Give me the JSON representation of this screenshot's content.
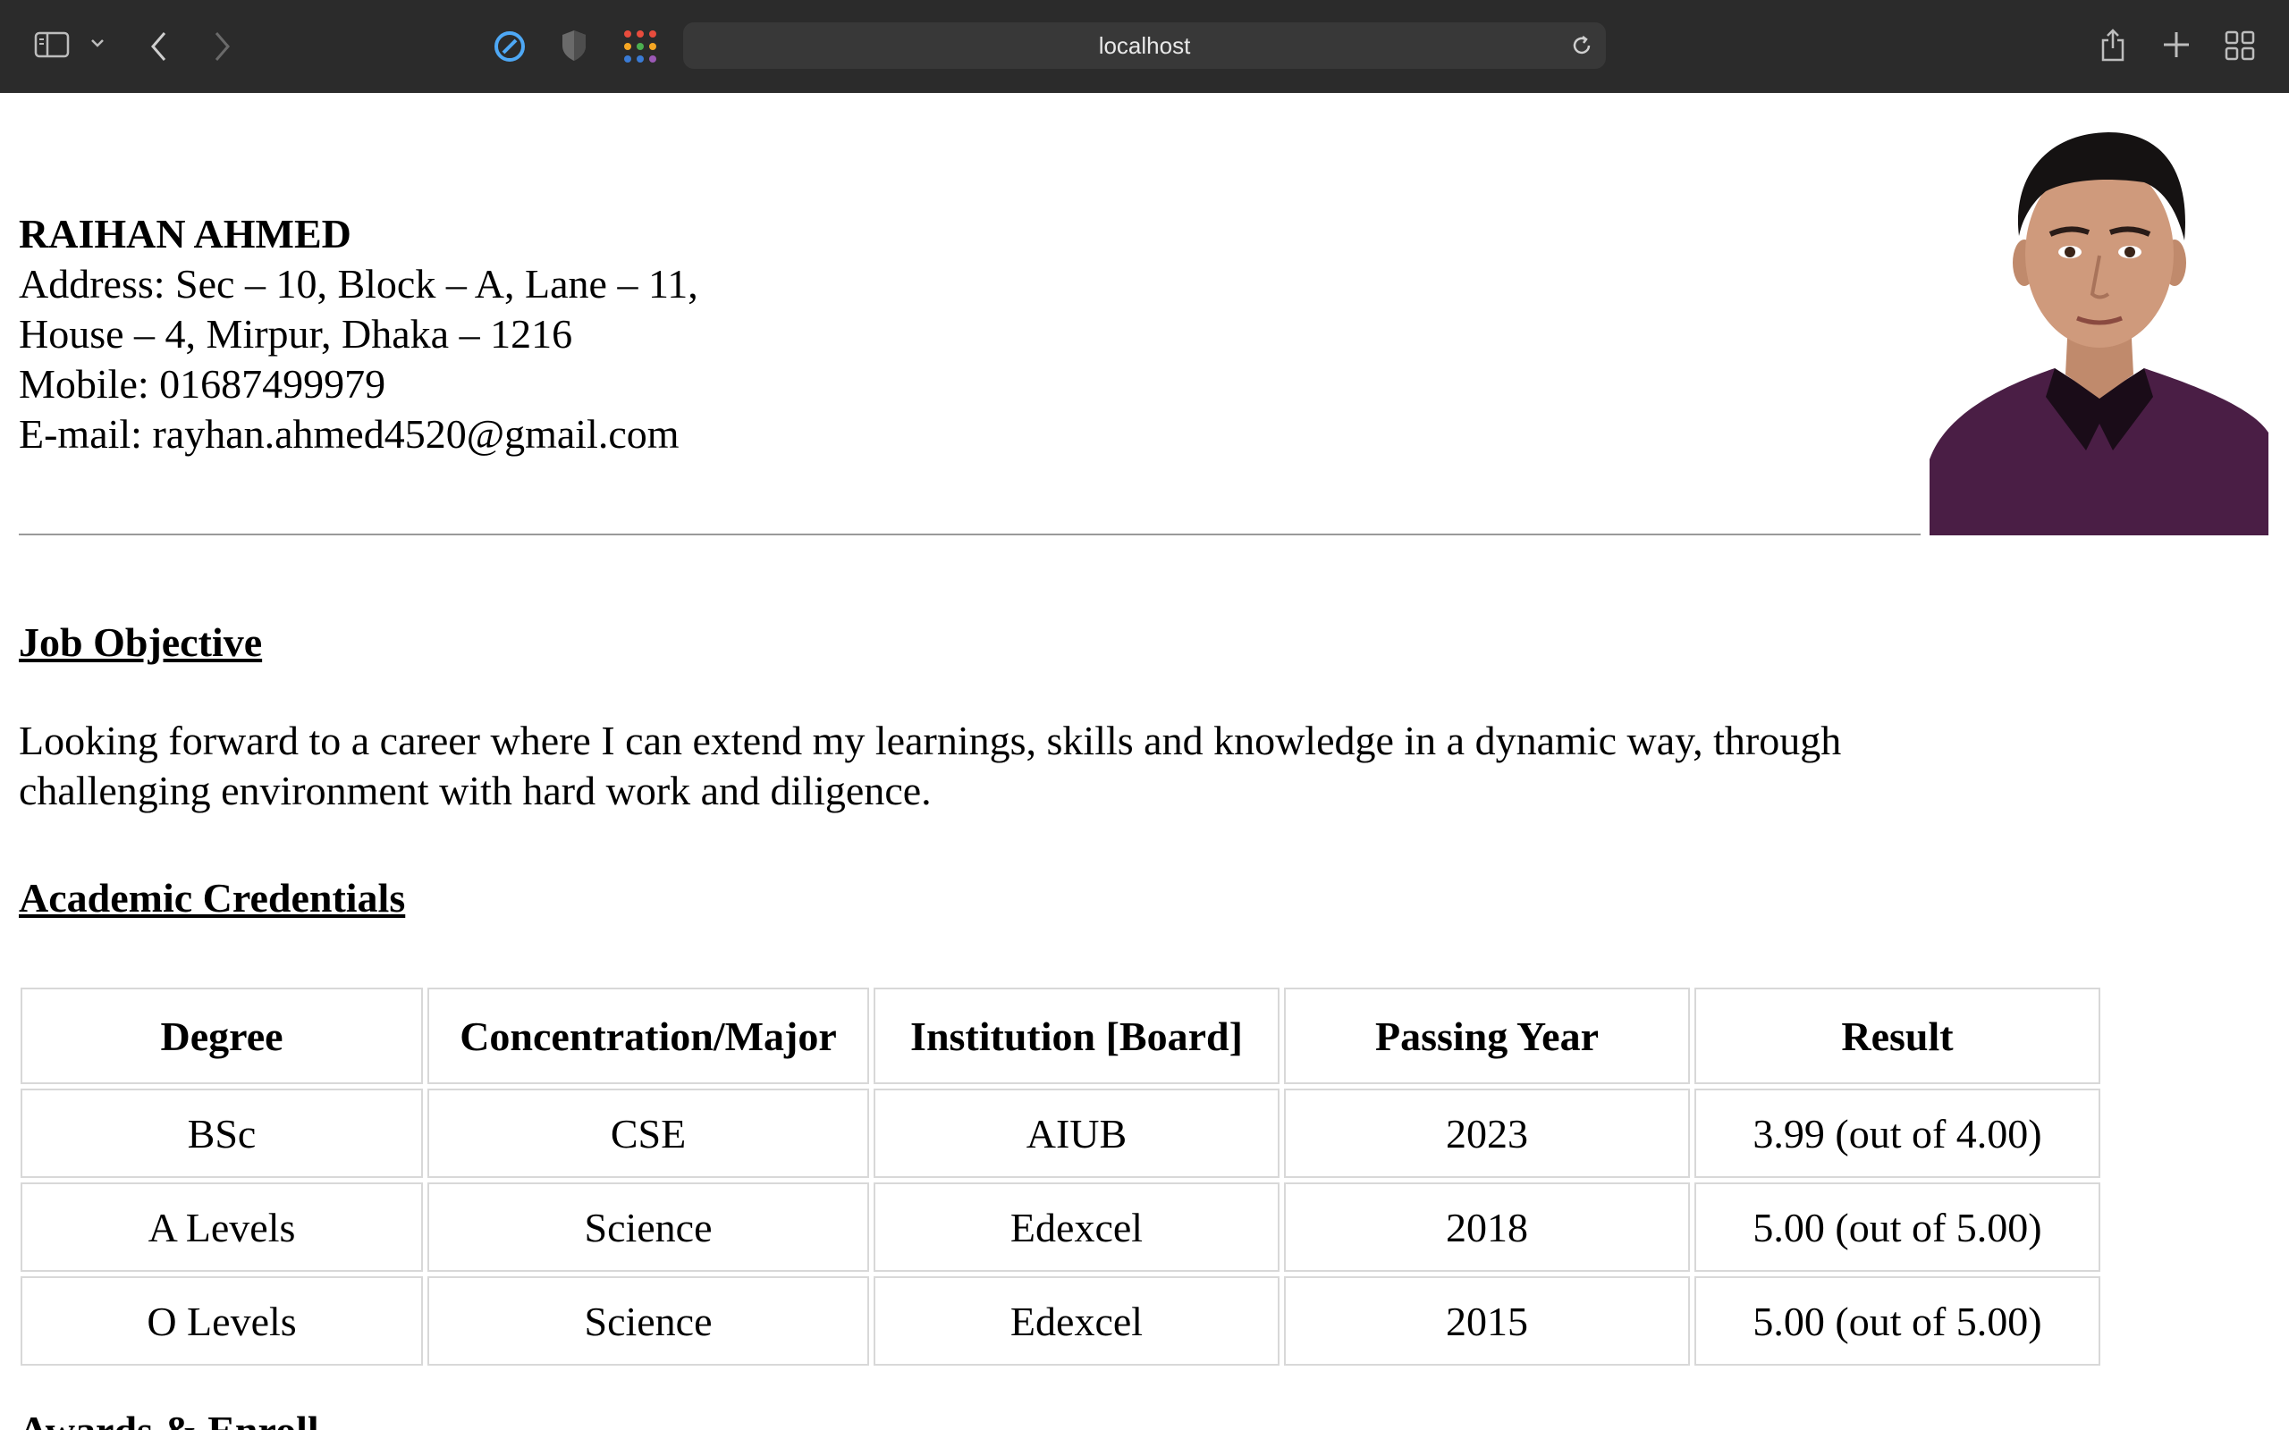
{
  "browser": {
    "url": "localhost"
  },
  "resume": {
    "name": "RAIHAN AHMED",
    "address_line1": "Address: Sec – 10, Block – A, Lane – 11,",
    "address_line2": "House – 4, Mirpur, Dhaka – 1216",
    "mobile": "Mobile: 01687499979",
    "email": "E-mail: rayhan.ahmed4520@gmail.com",
    "job_objective_heading": "Job Objective",
    "job_objective_line1": "Looking forward to a career where I can extend my learnings, skills and knowledge in a dynamic way, through",
    "job_objective_line2": "challenging environment with hard work and diligence.",
    "academic_heading": "Academic Credentials",
    "academic_table": {
      "headers": [
        "Degree",
        "Concentration/Major",
        "Institution [Board]",
        "Passing Year",
        "Result"
      ],
      "rows": [
        [
          "BSc",
          "CSE",
          "AIUB",
          "2023",
          "3.99 (out of 4.00)"
        ],
        [
          "A Levels",
          "Science",
          "Edexcel",
          "2018",
          "5.00 (out of 5.00)"
        ],
        [
          "O Levels",
          "Science",
          "Edexcel",
          "2015",
          "5.00 (out of 5.00)"
        ]
      ]
    },
    "next_heading_partial": "Awards & Enroll"
  },
  "colors": {
    "toolbar_bg": "#2b2b2b",
    "addressbar_bg": "#383838",
    "shirt": "#4a1e45"
  }
}
